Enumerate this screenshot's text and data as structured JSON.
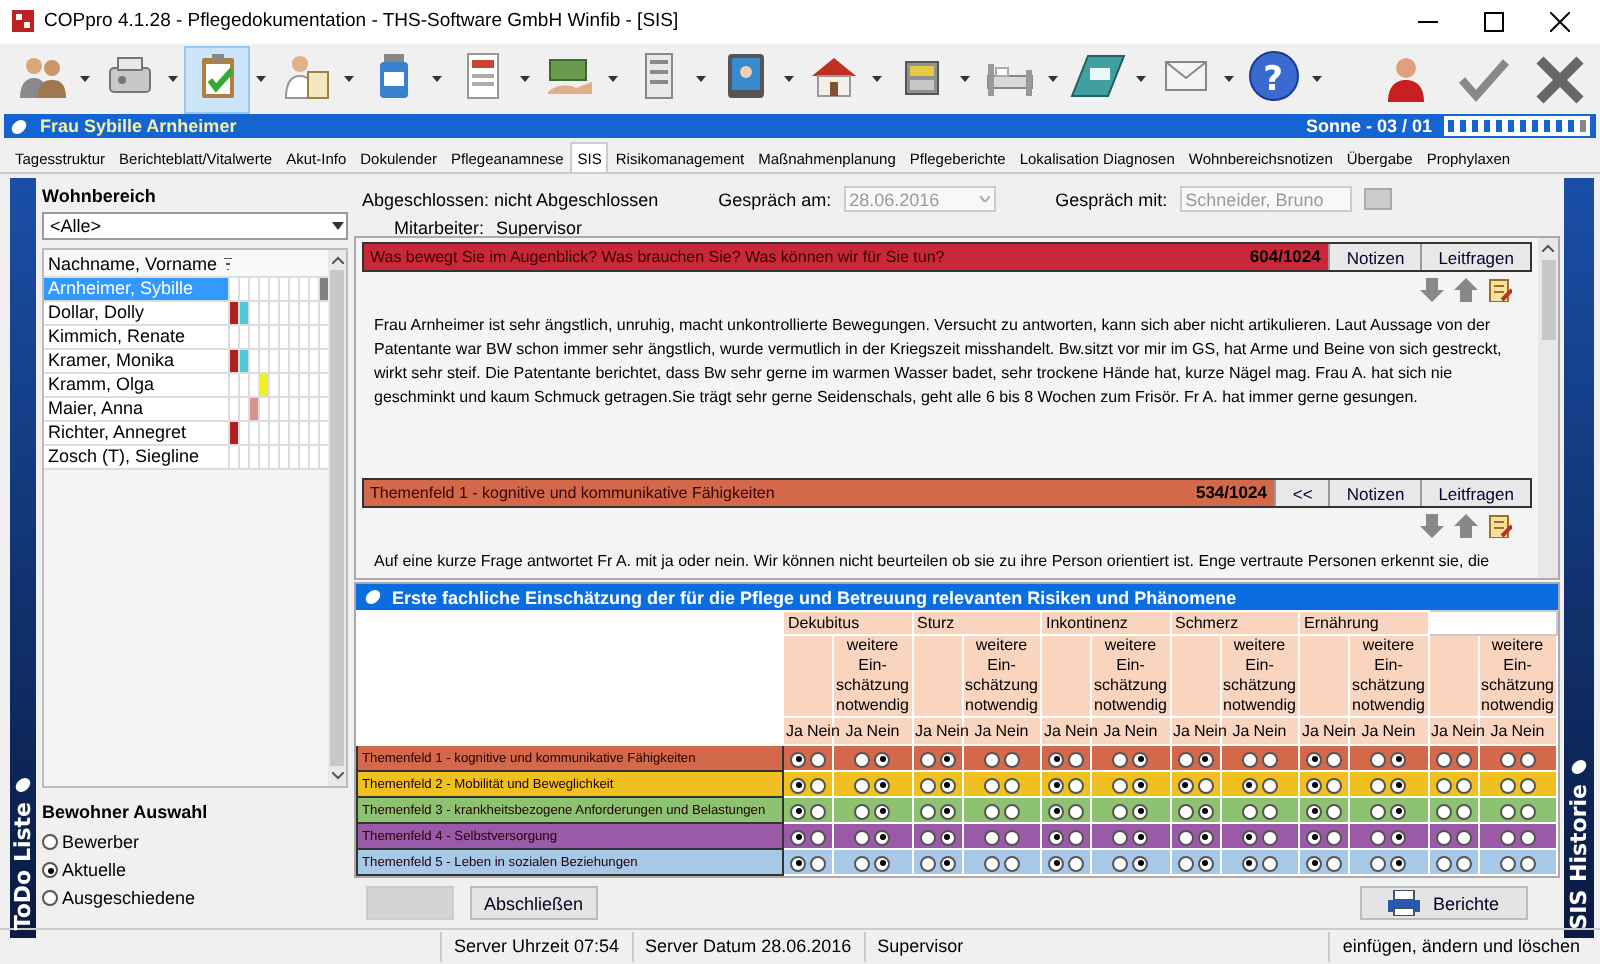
{
  "window": {
    "title": "COPpro 4.1.28 - Pflegedokumentation - THS-Software GmbH Winfib - [SIS]"
  },
  "toolbar": {
    "tools": [
      {
        "kind": "people",
        "selected": false
      },
      {
        "kind": "device",
        "selected": false
      },
      {
        "kind": "clipboard",
        "selected": true
      },
      {
        "kind": "person-document",
        "selected": false
      },
      {
        "kind": "bottle",
        "selected": false
      },
      {
        "kind": "document",
        "selected": false
      },
      {
        "kind": "money",
        "selected": false
      },
      {
        "kind": "form",
        "selected": false
      },
      {
        "kind": "monitor",
        "selected": false
      },
      {
        "kind": "house",
        "selected": false
      },
      {
        "kind": "cabinet",
        "selected": false
      },
      {
        "kind": "bed",
        "selected": false
      },
      {
        "kind": "tray",
        "selected": false
      },
      {
        "kind": "envelope",
        "selected": false
      },
      {
        "kind": "help",
        "selected": false,
        "glyph": "?"
      }
    ],
    "actions": [
      {
        "kind": "user"
      },
      {
        "kind": "confirm"
      },
      {
        "kind": "cancel"
      }
    ]
  },
  "patient_bar": {
    "name": "Frau Sybille Arnheimer",
    "unit": "Sonne - 03 / 01"
  },
  "tabs": [
    {
      "label": "Tagesstruktur",
      "selected": false
    },
    {
      "label": "Berichteblatt/Vitalwerte",
      "selected": false
    },
    {
      "label": "Akut-Info",
      "selected": false
    },
    {
      "label": "Dokulender",
      "selected": false
    },
    {
      "label": "Pflegeanamnese",
      "selected": false
    },
    {
      "label": "SIS",
      "selected": true
    },
    {
      "label": "Risikomanagement",
      "selected": false
    },
    {
      "label": "Maßnahmenplanung",
      "selected": false
    },
    {
      "label": "Pflegeberichte",
      "selected": false
    },
    {
      "label": "Lokalisation Diagnosen",
      "selected": false
    },
    {
      "label": "Wohnbereichsnotizen",
      "selected": false
    },
    {
      "label": "Übergabe",
      "selected": false
    },
    {
      "label": "Prophylaxen",
      "selected": false
    }
  ],
  "todo_strip": {
    "label": "ToDo Liste"
  },
  "history_strip": {
    "label": "SIS Historie"
  },
  "residents": {
    "area_label": "Wohnbereich",
    "area_value": "<Alle>",
    "column": "Nachname, Vorname",
    "rows": [
      {
        "name": "Arnheimer, Sybille",
        "selected": true,
        "marks": [
          {
            "color": "#ffffff"
          },
          {
            "color": "#ffffff"
          },
          {
            "color": "#ffffff"
          },
          {
            "color": "#ffffff"
          },
          {
            "color": "#ffffff"
          },
          {
            "color": "#ffffff"
          },
          {
            "color": "#ffffff"
          },
          {
            "color": "#ffffff"
          },
          {
            "color": "#ffffff"
          },
          {
            "color": "#808080"
          }
        ]
      },
      {
        "name": "Dollar, Dolly",
        "selected": false,
        "marks": [
          {
            "color": "#b02020"
          },
          {
            "color": "#50c8d8"
          },
          {
            "color": "#ffffff"
          },
          {
            "color": "#ffffff"
          },
          {
            "color": "#ffffff"
          },
          {
            "color": "#ffffff"
          },
          {
            "color": "#ffffff"
          },
          {
            "color": "#ffffff"
          },
          {
            "color": "#ffffff"
          },
          {
            "color": "#ffffff"
          }
        ]
      },
      {
        "name": "Kimmich, Renate",
        "selected": false,
        "marks": [
          {
            "color": "#ffffff"
          },
          {
            "color": "#ffffff"
          },
          {
            "color": "#ffffff"
          },
          {
            "color": "#ffffff"
          },
          {
            "color": "#ffffff"
          },
          {
            "color": "#ffffff"
          },
          {
            "color": "#ffffff"
          },
          {
            "color": "#ffffff"
          },
          {
            "color": "#ffffff"
          },
          {
            "color": "#ffffff"
          }
        ]
      },
      {
        "name": "Kramer, Monika",
        "selected": false,
        "marks": [
          {
            "color": "#b02020"
          },
          {
            "color": "#50c8d8"
          },
          {
            "color": "#ffffff"
          },
          {
            "color": "#ffffff"
          },
          {
            "color": "#ffffff"
          },
          {
            "color": "#ffffff"
          },
          {
            "color": "#ffffff"
          },
          {
            "color": "#ffffff"
          },
          {
            "color": "#ffffff"
          },
          {
            "color": "#ffffff"
          }
        ]
      },
      {
        "name": "Kramm, Olga",
        "selected": false,
        "marks": [
          {
            "color": "#ffffff"
          },
          {
            "color": "#ffffff"
          },
          {
            "color": "#ffffff"
          },
          {
            "color": "#f0f020"
          },
          {
            "color": "#ffffff"
          },
          {
            "color": "#ffffff"
          },
          {
            "color": "#ffffff"
          },
          {
            "color": "#ffffff"
          },
          {
            "color": "#ffffff"
          },
          {
            "color": "#ffffff"
          }
        ]
      },
      {
        "name": "Maier, Anna",
        "selected": false,
        "marks": [
          {
            "color": "#ffffff"
          },
          {
            "color": "#ffffff"
          },
          {
            "color": "#d89090"
          },
          {
            "color": "#ffffff"
          },
          {
            "color": "#ffffff"
          },
          {
            "color": "#ffffff"
          },
          {
            "color": "#ffffff"
          },
          {
            "color": "#ffffff"
          },
          {
            "color": "#ffffff"
          },
          {
            "color": "#ffffff"
          }
        ]
      },
      {
        "name": "Richter, Annegret",
        "selected": false,
        "marks": [
          {
            "color": "#b02020"
          },
          {
            "color": "#ffffff"
          },
          {
            "color": "#ffffff"
          },
          {
            "color": "#ffffff"
          },
          {
            "color": "#ffffff"
          },
          {
            "color": "#ffffff"
          },
          {
            "color": "#ffffff"
          },
          {
            "color": "#ffffff"
          },
          {
            "color": "#ffffff"
          },
          {
            "color": "#ffffff"
          }
        ]
      },
      {
        "name": "Zosch (T), Siegline",
        "selected": false,
        "marks": [
          {
            "color": "#ffffff"
          },
          {
            "color": "#ffffff"
          },
          {
            "color": "#ffffff"
          },
          {
            "color": "#ffffff"
          },
          {
            "color": "#ffffff"
          },
          {
            "color": "#ffffff"
          },
          {
            "color": "#ffffff"
          },
          {
            "color": "#ffffff"
          },
          {
            "color": "#ffffff"
          },
          {
            "color": "#ffffff"
          }
        ]
      }
    ],
    "selection_label": "Bewohner Auswahl",
    "options": [
      {
        "label": "Bewerber",
        "selected": false
      },
      {
        "label": "Aktuelle",
        "selected": true
      },
      {
        "label": "Ausgeschiedene",
        "selected": false
      }
    ]
  },
  "interview": {
    "status": "Abgeschlossen: nicht Abgeschlossen",
    "date_label": "Gespräch am:",
    "date": "28.06.2016",
    "partner_label": "Gespräch mit:",
    "partner": "Schneider, Bruno",
    "staff_label": "Mitarbeiter:",
    "staff": "Supervisor"
  },
  "sections": [
    {
      "title": "Was bewegt Sie im Augenblick? Was brauchen Sie? Was können wir für Sie tun?",
      "color": "#c8283a",
      "count": "604/1024",
      "buttons": [
        "Notizen",
        "Leitfragen"
      ],
      "text": "Frau Arnheimer ist sehr ängstlich, unruhig, macht unkontrollierte Bewegungen. Versucht zu antworten, kann sich aber nicht artikulieren. Laut Aussage von der Patentante war BW schon immer sehr ängstlich, wurde vermutlich in der Kriegszeit misshandelt. Bw.sitzt vor mir im GS, hat Arme und Beine von sich gestreckt, wirkt sehr steif. Die Patentante berichtet, dass Bw sehr gerne im warmen Wasser badet, sehr trockene Hände hat, kurze Nägel mag. Frau A. hat sich nie geschminkt und kaum Schmuck getragen.Sie trägt sehr gerne Seidenschals, geht alle 6 bis 8 Wochen zum Frisör. Fr A. hat immer gerne gesungen."
    },
    {
      "title": "Themenfeld 1 - kognitive und kommunikative Fähigkeiten",
      "color": "#d4684a",
      "count": "534/1024",
      "buttons": [
        "<<",
        "Notizen",
        "Leitfragen"
      ],
      "text": "Auf eine kurze Frage antwortet Fr A. mit ja oder nein. Wir können nicht beurteilen ob sie zu ihre Person orientiert ist. Enge vertraute Personen erkennt sie, die"
    }
  ],
  "matrix": {
    "title": "Erste fachliche Einschätzung der für die Pflege und Betreuung relevanten Risiken und Phänomene",
    "groups": [
      {
        "name": "Dekubitus",
        "assessment_label": "weitere Ein-\nschätzung\nnotwendig",
        "yes_no": [
          [
            "Ja",
            "Nein"
          ],
          [
            "Ja",
            "Nein"
          ]
        ]
      },
      {
        "name": "Sturz",
        "assessment_label": "weitere Ein-\nschätzung\nnotwendig",
        "yes_no": [
          [
            "Ja",
            "Nein"
          ],
          [
            "Ja",
            "Nein"
          ]
        ]
      },
      {
        "name": "Inkontinenz",
        "assessment_label": "weitere Ein-\nschätzung\nnotwendig",
        "yes_no": [
          [
            "Ja",
            "Nein"
          ],
          [
            "Ja",
            "Nein"
          ]
        ]
      },
      {
        "name": "Schmerz",
        "assessment_label": "weitere Ein-\nschätzung\nnotwendig",
        "yes_no": [
          [
            "Ja",
            "Nein"
          ],
          [
            "Ja",
            "Nein"
          ]
        ]
      },
      {
        "name": "Ernährung",
        "assessment_label": "weitere Ein-\nschätzung\nnotwendig",
        "yes_no": [
          [
            "Ja",
            "Nein"
          ],
          [
            "Ja",
            "Nein"
          ]
        ]
      },
      {
        "assessment_label": "weitere Ein-\nschätzung\nnotwendig",
        "yes_no": [
          [
            "Ja",
            "Nein"
          ],
          [
            "Ja",
            "Nein"
          ]
        ]
      }
    ],
    "rows": [
      {
        "label": "Themenfeld 1 - kognitive und kommunikative Fähigkeiten",
        "color": "#d4684a",
        "cells": [
          {
            "yes": true,
            "no": false
          },
          {
            "yes": false,
            "no": true
          },
          {
            "yes": false,
            "no": true
          },
          {
            "yes": false,
            "no": false
          },
          {
            "yes": true,
            "no": false
          },
          {
            "yes": false,
            "no": true
          },
          {
            "yes": false,
            "no": true
          },
          {
            "yes": false,
            "no": false
          },
          {
            "yes": true,
            "no": false
          },
          {
            "yes": false,
            "no": true
          },
          {
            "yes": false,
            "no": false
          },
          {
            "yes": false,
            "no": false
          }
        ]
      },
      {
        "label": "Themenfeld 2 - Mobilität und Beweglichkeit",
        "color": "#f0c020",
        "cells": [
          {
            "yes": true,
            "no": false
          },
          {
            "yes": false,
            "no": true
          },
          {
            "yes": false,
            "no": true
          },
          {
            "yes": false,
            "no": false
          },
          {
            "yes": true,
            "no": false
          },
          {
            "yes": false,
            "no": true
          },
          {
            "yes": true,
            "no": false
          },
          {
            "yes": true,
            "no": false
          },
          {
            "yes": true,
            "no": false
          },
          {
            "yes": false,
            "no": true
          },
          {
            "yes": false,
            "no": false
          },
          {
            "yes": false,
            "no": false
          }
        ]
      },
      {
        "label": "Themenfeld 3 - krankheitsbezogene Anforderungen und Belastungen",
        "color": "#8cc270",
        "cells": [
          {
            "yes": true,
            "no": false
          },
          {
            "yes": false,
            "no": true
          },
          {
            "yes": false,
            "no": true
          },
          {
            "yes": false,
            "no": false
          },
          {
            "yes": true,
            "no": false
          },
          {
            "yes": false,
            "no": true
          },
          {
            "yes": false,
            "no": true
          },
          {
            "yes": false,
            "no": false
          },
          {
            "yes": true,
            "no": false
          },
          {
            "yes": false,
            "no": true
          },
          {
            "yes": false,
            "no": false
          },
          {
            "yes": false,
            "no": false
          }
        ]
      },
      {
        "label": "Themenfeld 4 - Selbstversorgung",
        "color": "#9a5aa8",
        "cells": [
          {
            "yes": true,
            "no": false
          },
          {
            "yes": false,
            "no": true
          },
          {
            "yes": false,
            "no": true
          },
          {
            "yes": false,
            "no": false
          },
          {
            "yes": true,
            "no": false
          },
          {
            "yes": false,
            "no": true
          },
          {
            "yes": false,
            "no": true
          },
          {
            "yes": true,
            "no": false
          },
          {
            "yes": true,
            "no": false
          },
          {
            "yes": false,
            "no": true
          },
          {
            "yes": false,
            "no": false
          },
          {
            "yes": false,
            "no": false
          }
        ]
      },
      {
        "label": "Themenfeld 5 - Leben in sozialen Beziehungen",
        "color": "#a8c8e8",
        "cells": [
          {
            "yes": true,
            "no": false
          },
          {
            "yes": false,
            "no": true
          },
          {
            "yes": false,
            "no": true
          },
          {
            "yes": false,
            "no": false
          },
          {
            "yes": true,
            "no": false
          },
          {
            "yes": false,
            "no": true
          },
          {
            "yes": false,
            "no": true
          },
          {
            "yes": true,
            "no": false
          },
          {
            "yes": true,
            "no": false
          },
          {
            "yes": false,
            "no": true
          },
          {
            "yes": false,
            "no": false
          },
          {
            "yes": false,
            "no": false
          }
        ]
      }
    ]
  },
  "buttons": [
    {
      "kind": "blank",
      "disabled": true
    },
    {
      "kind": "text",
      "label": "Abschließen",
      "disabled": false
    },
    {
      "kind": "print",
      "label": "Berichte",
      "disabled": false
    }
  ],
  "status_bar": [
    "Server Uhrzeit 07:54",
    "Server Datum 28.06.2016",
    "Supervisor",
    "einfügen, ändern und löschen"
  ]
}
